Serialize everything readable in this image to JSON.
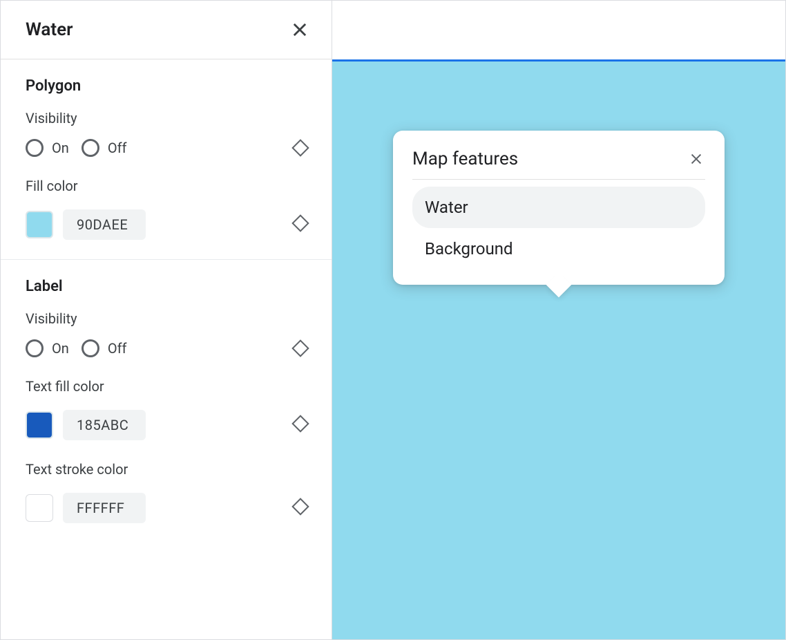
{
  "panel": {
    "title": "Water",
    "polygon": {
      "heading": "Polygon",
      "visibility_label": "Visibility",
      "on": "On",
      "off": "Off",
      "fill_label": "Fill color",
      "fill_hex": "90DAEE",
      "fill_color": "#90DAEE"
    },
    "label": {
      "heading": "Label",
      "visibility_label": "Visibility",
      "on": "On",
      "off": "Off",
      "text_fill_label": "Text fill color",
      "text_fill_hex": "185ABC",
      "text_fill_color": "#185ABC",
      "text_stroke_label": "Text stroke color",
      "text_stroke_hex": "FFFFFF",
      "text_stroke_color": "#FFFFFF"
    }
  },
  "preview": {
    "water_color": "#90DAEE",
    "popover": {
      "title": "Map features",
      "items": [
        "Water",
        "Background"
      ],
      "selected_index": 0
    }
  }
}
